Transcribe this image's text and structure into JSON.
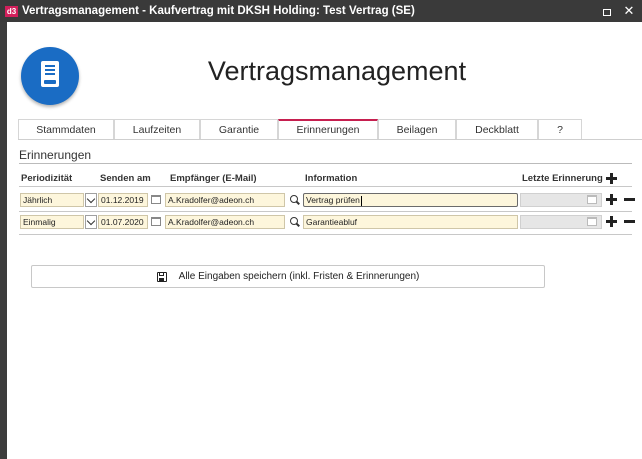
{
  "window": {
    "app_icon": "d3",
    "title": "Vertragsmanagement - Kaufvertrag mit DKSH Holding: Test Vertrag (SE)",
    "restore_icon": "restore-icon",
    "close_label": "✕"
  },
  "header": {
    "logo_icon": "contract-document-icon",
    "app_title": "Vertragsmanagement"
  },
  "tabs": [
    {
      "label": "Stammdaten",
      "active": false
    },
    {
      "label": "Laufzeiten",
      "active": false
    },
    {
      "label": "Garantie",
      "active": false
    },
    {
      "label": "Erinnerungen",
      "active": true
    },
    {
      "label": "Beilagen",
      "active": false
    },
    {
      "label": "Deckblatt",
      "active": false
    },
    {
      "label": "?",
      "active": false
    }
  ],
  "section": {
    "title": "Erinnerungen",
    "columns": {
      "periodizitaet": "Periodizität",
      "senden_am": "Senden am",
      "empfaenger": "Empfänger (E-Mail)",
      "information": "Information",
      "letzte_erinnerung": "Letzte Erinnerung"
    },
    "rows": [
      {
        "periodizitaet": "Jährlich",
        "senden_am": "01.12.2019",
        "empfaenger": "A.Kradolfer@adeon.ch",
        "information": "Vertrag prüfen",
        "letzte_erinnerung": "",
        "focused": true
      },
      {
        "periodizitaet": "Einmalig",
        "senden_am": "01.07.2020",
        "empfaenger": "A.Kradolfer@adeon.ch",
        "information": "Garantieabluf",
        "letzte_erinnerung": "",
        "focused": false
      }
    ]
  },
  "save_button": {
    "icon": "floppy-disk-icon",
    "label": "Alle Eingaben speichern (inkl. Fristen & Erinnerungen)"
  },
  "colors": {
    "accent": "#c61f4f",
    "logo": "#1a6cc4",
    "field_background": "#fdf6dc",
    "titlebar": "#3a3a3a"
  }
}
